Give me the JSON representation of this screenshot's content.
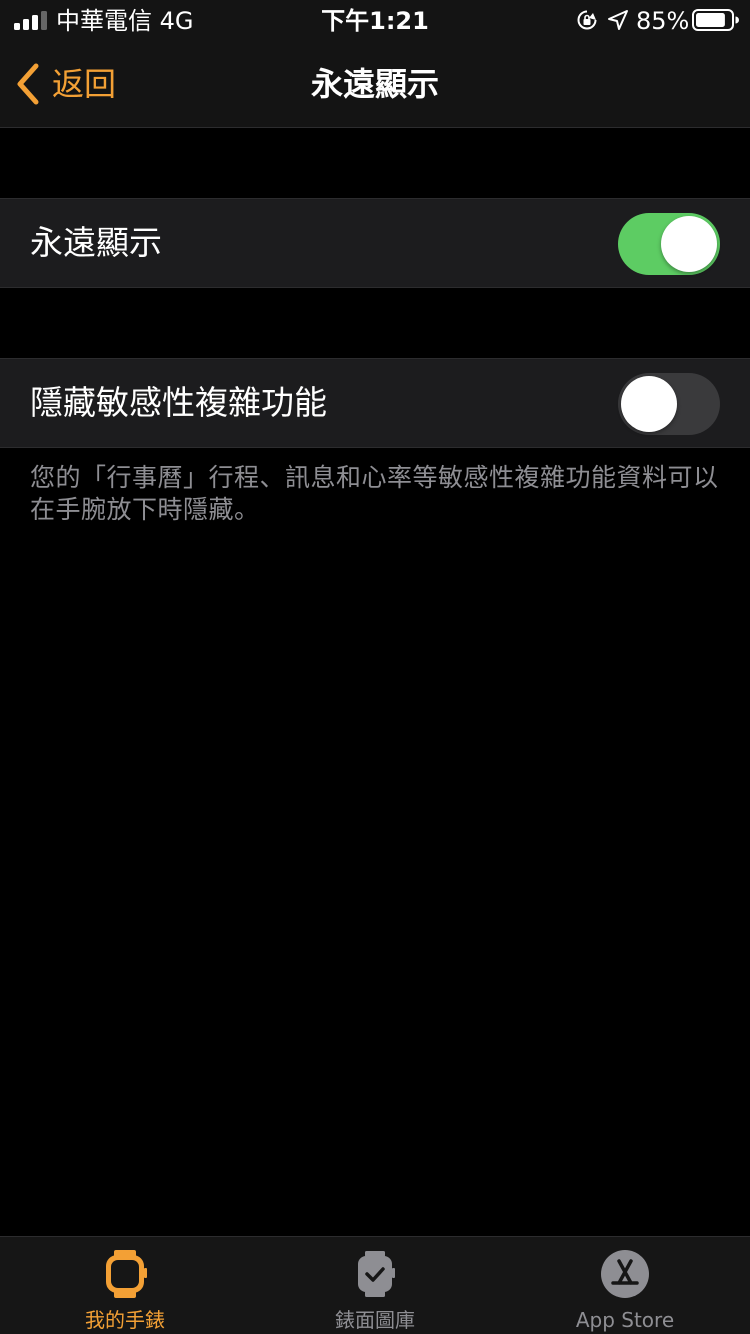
{
  "status_bar": {
    "carrier": "中華電信  4G",
    "time": "下午1:21",
    "battery": "85%",
    "battery_level": 0.85
  },
  "nav": {
    "back_label": "返回",
    "title": "永遠顯示"
  },
  "settings": [
    {
      "label": "永遠顯示",
      "on": true
    },
    {
      "label": "隱藏敏感性複雜功能",
      "on": false
    }
  ],
  "footnote": "您的「行事曆」行程、訊息和心率等敏感性複雜功能資料可以在手腕放下時隱藏。",
  "tabs": [
    {
      "label": "我的手錶",
      "icon": "watch-icon",
      "active": true
    },
    {
      "label": "錶面圖庫",
      "icon": "watch-face-icon",
      "active": false
    },
    {
      "label": "App Store",
      "icon": "app-store-icon",
      "active": false
    }
  ],
  "colors": {
    "accent": "#f3a035",
    "toggle_on": "#5dcc63",
    "toggle_off": "#3a3a3c",
    "row_bg": "#1c1c1e",
    "secondary_text": "#8e8e93"
  }
}
